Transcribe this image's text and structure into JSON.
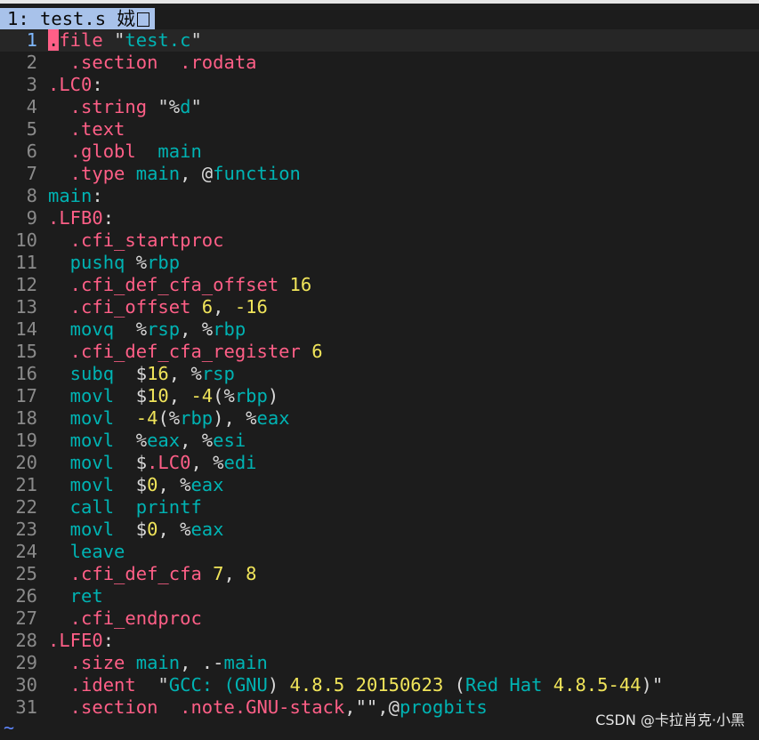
{
  "tab": {
    "label": "1: test.s 娀"
  },
  "lines": [
    {
      "num": "1",
      "segs": [
        [
          "cursor",
          "."
        ],
        [
          "dir",
          "file "
        ],
        [
          "pun",
          "\""
        ],
        [
          "str",
          "test.c"
        ],
        [
          "pun",
          "\""
        ]
      ]
    },
    {
      "num": "2",
      "segs": [
        [
          "dir",
          "  .section  .rodata"
        ]
      ]
    },
    {
      "num": "3",
      "segs": [
        [
          "dir",
          ".LC0"
        ],
        [
          "pun",
          ":"
        ]
      ]
    },
    {
      "num": "4",
      "segs": [
        [
          "dir",
          "  .string "
        ],
        [
          "pun",
          "\"%"
        ],
        [
          "str",
          "d"
        ],
        [
          "pun",
          "\""
        ]
      ]
    },
    {
      "num": "5",
      "segs": [
        [
          "dir",
          "  .text"
        ]
      ]
    },
    {
      "num": "6",
      "segs": [
        [
          "dir",
          "  .globl  "
        ],
        [
          "ins",
          "main"
        ]
      ]
    },
    {
      "num": "7",
      "segs": [
        [
          "dir",
          "  .type "
        ],
        [
          "ins",
          "main"
        ],
        [
          "pun",
          ", @"
        ],
        [
          "ins",
          "function"
        ]
      ]
    },
    {
      "num": "8",
      "segs": [
        [
          "ins",
          "main"
        ],
        [
          "pun",
          ":"
        ]
      ]
    },
    {
      "num": "9",
      "segs": [
        [
          "dir",
          ".LFB0"
        ],
        [
          "pun",
          ":"
        ]
      ]
    },
    {
      "num": "10",
      "segs": [
        [
          "dir",
          "  .cfi_startproc"
        ]
      ]
    },
    {
      "num": "11",
      "segs": [
        [
          "ins",
          "  pushq "
        ],
        [
          "pun",
          "%"
        ],
        [
          "reg",
          "rbp"
        ]
      ]
    },
    {
      "num": "12",
      "segs": [
        [
          "dir",
          "  .cfi_def_cfa_offset "
        ],
        [
          "num",
          "16"
        ]
      ]
    },
    {
      "num": "13",
      "segs": [
        [
          "dir",
          "  .cfi_offset "
        ],
        [
          "num",
          "6"
        ],
        [
          "pun",
          ", "
        ],
        [
          "num",
          "-16"
        ]
      ]
    },
    {
      "num": "14",
      "segs": [
        [
          "ins",
          "  movq  "
        ],
        [
          "pun",
          "%"
        ],
        [
          "reg",
          "rsp"
        ],
        [
          "pun",
          ", %"
        ],
        [
          "reg",
          "rbp"
        ]
      ]
    },
    {
      "num": "15",
      "segs": [
        [
          "dir",
          "  .cfi_def_cfa_register "
        ],
        [
          "num",
          "6"
        ]
      ]
    },
    {
      "num": "16",
      "segs": [
        [
          "ins",
          "  subq  "
        ],
        [
          "pun",
          "$"
        ],
        [
          "num",
          "16"
        ],
        [
          "pun",
          ", %"
        ],
        [
          "reg",
          "rsp"
        ]
      ]
    },
    {
      "num": "17",
      "segs": [
        [
          "ins",
          "  movl  "
        ],
        [
          "pun",
          "$"
        ],
        [
          "num",
          "10"
        ],
        [
          "pun",
          ", "
        ],
        [
          "num",
          "-4"
        ],
        [
          "pun",
          "(%"
        ],
        [
          "reg",
          "rbp"
        ],
        [
          "pun",
          ")"
        ]
      ]
    },
    {
      "num": "18",
      "segs": [
        [
          "ins",
          "  movl  "
        ],
        [
          "num",
          "-4"
        ],
        [
          "pun",
          "(%"
        ],
        [
          "reg",
          "rbp"
        ],
        [
          "pun",
          "), %"
        ],
        [
          "reg",
          "eax"
        ]
      ]
    },
    {
      "num": "19",
      "segs": [
        [
          "ins",
          "  movl  "
        ],
        [
          "pun",
          "%"
        ],
        [
          "reg",
          "eax"
        ],
        [
          "pun",
          ", %"
        ],
        [
          "reg",
          "esi"
        ]
      ]
    },
    {
      "num": "20",
      "segs": [
        [
          "ins",
          "  movl  "
        ],
        [
          "pun",
          "$"
        ],
        [
          "dir",
          ".LC0"
        ],
        [
          "pun",
          ", %"
        ],
        [
          "reg",
          "edi"
        ]
      ]
    },
    {
      "num": "21",
      "segs": [
        [
          "ins",
          "  movl  "
        ],
        [
          "pun",
          "$"
        ],
        [
          "num",
          "0"
        ],
        [
          "pun",
          ", %"
        ],
        [
          "reg",
          "eax"
        ]
      ]
    },
    {
      "num": "22",
      "segs": [
        [
          "ins",
          "  call  printf"
        ]
      ]
    },
    {
      "num": "23",
      "segs": [
        [
          "ins",
          "  movl  "
        ],
        [
          "pun",
          "$"
        ],
        [
          "num",
          "0"
        ],
        [
          "pun",
          ", %"
        ],
        [
          "reg",
          "eax"
        ]
      ]
    },
    {
      "num": "24",
      "segs": [
        [
          "ins",
          "  leave"
        ]
      ]
    },
    {
      "num": "25",
      "segs": [
        [
          "dir",
          "  .cfi_def_cfa "
        ],
        [
          "num",
          "7"
        ],
        [
          "pun",
          ", "
        ],
        [
          "num",
          "8"
        ]
      ]
    },
    {
      "num": "26",
      "segs": [
        [
          "ins",
          "  ret"
        ]
      ]
    },
    {
      "num": "27",
      "segs": [
        [
          "dir",
          "  .cfi_endproc"
        ]
      ]
    },
    {
      "num": "28",
      "segs": [
        [
          "dir",
          ".LFE0"
        ],
        [
          "pun",
          ":"
        ]
      ]
    },
    {
      "num": "29",
      "segs": [
        [
          "dir",
          "  .size "
        ],
        [
          "ins",
          "main"
        ],
        [
          "pun",
          ", .-"
        ],
        [
          "ins",
          "main"
        ]
      ]
    },
    {
      "num": "30",
      "segs": [
        [
          "dir",
          "  .ident  "
        ],
        [
          "pun",
          "\""
        ],
        [
          "str",
          "GCC: ("
        ],
        [
          "str",
          "GNU"
        ],
        [
          "pun",
          ") "
        ],
        [
          "num",
          "4.8.5 20150623"
        ],
        [
          "pun",
          " ("
        ],
        [
          "str",
          "Red Hat "
        ],
        [
          "num",
          "4.8.5-44"
        ],
        [
          "pun",
          ")\""
        ]
      ]
    },
    {
      "num": "31",
      "segs": [
        [
          "dir",
          "  .section  .note.GNU-stack"
        ],
        [
          "pun",
          ",\"\",@"
        ],
        [
          "ins",
          "progbits"
        ]
      ]
    }
  ],
  "empty_line_marker": "~",
  "watermark": "CSDN @卡拉肖克·小黑",
  "colors": {
    "directive": "#ff5f87",
    "instruction": "#00b3b3",
    "number": "#f0e45a",
    "tab_bg": "#a8c2ea",
    "background": "#1c1c1c"
  }
}
